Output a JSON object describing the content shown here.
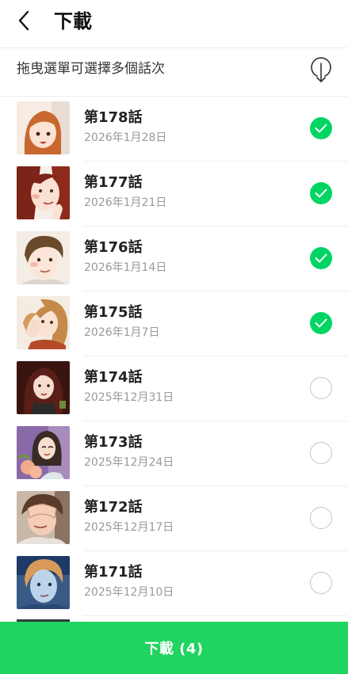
{
  "header": {
    "title": "下載",
    "back_icon": "chevron-left-icon"
  },
  "subbar": {
    "hint": "拖曳選單可選擇多個話次",
    "sort_icon": "download-arrow-circle-icon"
  },
  "episodes": [
    {
      "title": "第178話",
      "date": "2026年1月28日",
      "selected": true
    },
    {
      "title": "第177話",
      "date": "2026年1月21日",
      "selected": true
    },
    {
      "title": "第176話",
      "date": "2026年1月14日",
      "selected": true
    },
    {
      "title": "第175話",
      "date": "2026年1月7日",
      "selected": true
    },
    {
      "title": "第174話",
      "date": "2025年12月31日",
      "selected": false
    },
    {
      "title": "第173話",
      "date": "2025年12月24日",
      "selected": false
    },
    {
      "title": "第172話",
      "date": "2025年12月17日",
      "selected": false
    },
    {
      "title": "第171話",
      "date": "2025年12月10日",
      "selected": false
    }
  ],
  "footer": {
    "download_label": "下載 (4)"
  },
  "colors": {
    "accent": "#1fd45f",
    "check_on": "#00d564",
    "check_off_border": "#c4c4c4",
    "date_text": "#9a9a9a"
  }
}
